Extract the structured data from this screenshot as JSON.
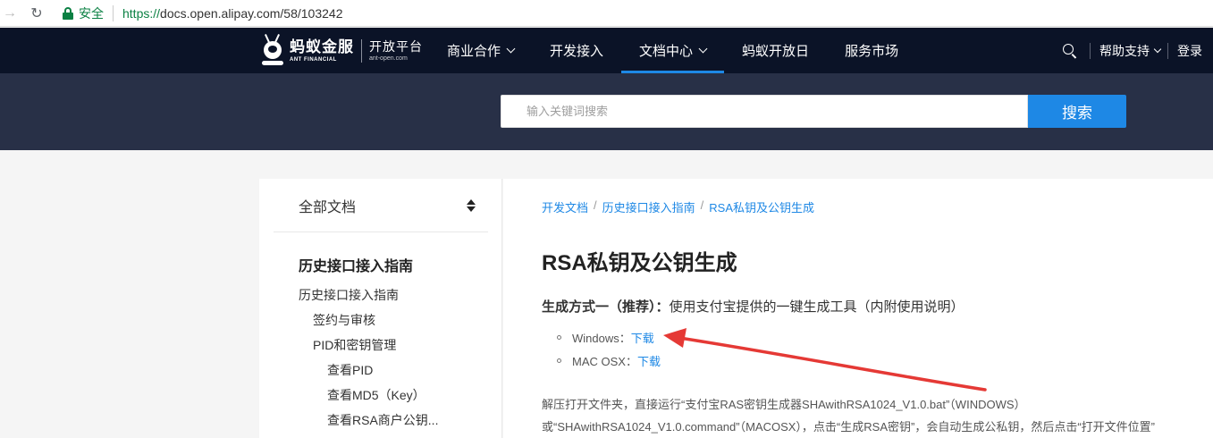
{
  "browser": {
    "secure_label": "安全",
    "url_scheme": "https://",
    "url_rest": "docs.open.alipay.com/58/103242"
  },
  "nav": {
    "logo_cn": "蚂蚁金服",
    "logo_en": "ANT FINANCIAL",
    "logo_sub_cn": "开放平台",
    "logo_sub_en": "ant-open.com",
    "items": [
      {
        "label": "商业合作",
        "dropdown": true
      },
      {
        "label": "开发接入",
        "dropdown": false
      },
      {
        "label": "文档中心",
        "dropdown": true,
        "active": true
      },
      {
        "label": "蚂蚁开放日",
        "dropdown": false
      },
      {
        "label": "服务市场",
        "dropdown": false
      }
    ],
    "help_label": "帮助支持",
    "login_label": "登录"
  },
  "search": {
    "placeholder": "输入关键词搜索",
    "button_label": "搜索"
  },
  "sidebar": {
    "header": "全部文档",
    "section_title": "历史接口接入指南",
    "items": [
      {
        "label": "历史接口接入指南",
        "level": 1
      },
      {
        "label": "签约与审核",
        "level": 2
      },
      {
        "label": "PID和密钥管理",
        "level": 2
      },
      {
        "label": "查看PID",
        "level": 3
      },
      {
        "label": "查看MD5（Key）",
        "level": 3
      },
      {
        "label": "查看RSA商户公钥...",
        "level": 3
      }
    ]
  },
  "main": {
    "breadcrumb": [
      "开发文档",
      "历史接口接入指南",
      "RSA私钥及公钥生成"
    ],
    "title": "RSA私钥及公钥生成",
    "method_bold": "生成方式一（推荐）：",
    "method_text": "使用支付宝提供的一键生成工具（内附使用说明）",
    "downloads": [
      {
        "platform": "Windows：",
        "link": "下载"
      },
      {
        "platform": "MAC OSX：",
        "link": "下载"
      }
    ],
    "paragraph_line1": "解压打开文件夹，直接运行“支付宝RAS密钥生成器SHAwithRSA1024_V1.0.bat”（WINDOWS）",
    "paragraph_line2": "或“SHAwithRSA1024_V1.0.command”（MACOSX），点击“生成RSA密钥”，会自动生成公私钥，然后点击“打开文件位置”"
  },
  "colors": {
    "nav_bg": "#0b1327",
    "search_band_bg": "#283047",
    "accent": "#1e88e5",
    "annotation_arrow": "#e53935"
  }
}
